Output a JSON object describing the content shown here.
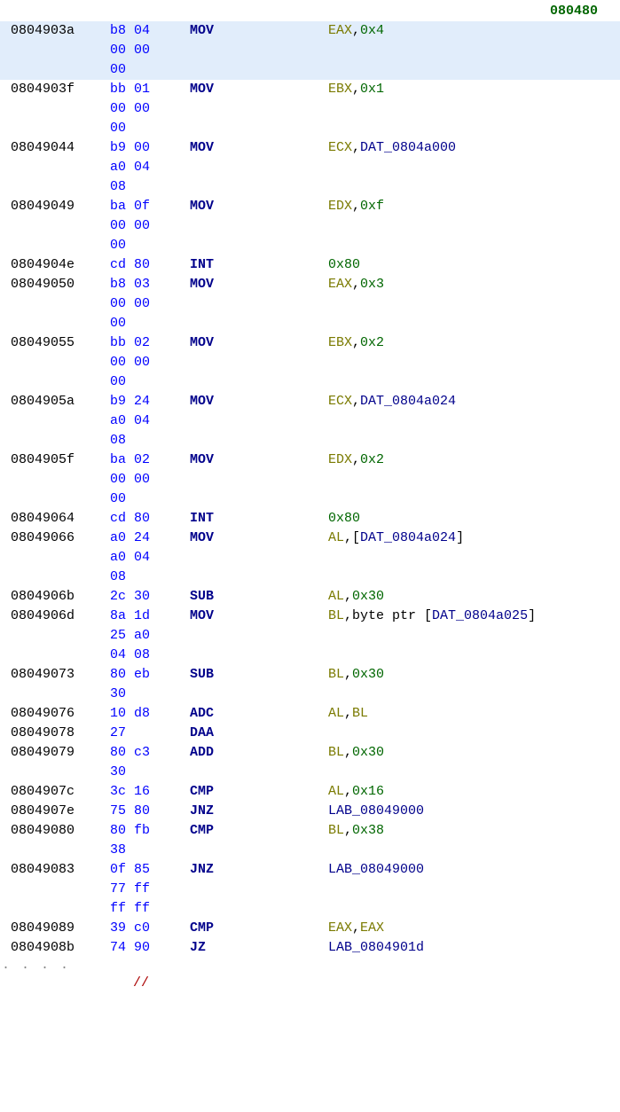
{
  "header_addr": "080480",
  "rows": [
    {
      "highlight": true,
      "addr": "0804903a",
      "bytes": [
        "b8 04",
        "00 00",
        "00"
      ],
      "mnemonic": "MOV",
      "ops": [
        {
          "t": "reg",
          "v": "EAX"
        },
        {
          "t": "punct",
          "v": ","
        },
        {
          "t": "num",
          "v": "0x4"
        }
      ]
    },
    {
      "addr": "0804903f",
      "bytes": [
        "bb 01",
        "00 00",
        "00"
      ],
      "mnemonic": "MOV",
      "ops": [
        {
          "t": "reg",
          "v": "EBX"
        },
        {
          "t": "punct",
          "v": ","
        },
        {
          "t": "num",
          "v": "0x1"
        }
      ]
    },
    {
      "addr": "08049044",
      "bytes": [
        "b9 00",
        "a0 04",
        "08"
      ],
      "mnemonic": "MOV",
      "ops": [
        {
          "t": "reg",
          "v": "ECX"
        },
        {
          "t": "punct",
          "v": ","
        },
        {
          "t": "label",
          "v": "DAT_0804a000"
        }
      ]
    },
    {
      "addr": "08049049",
      "bytes": [
        "ba 0f",
        "00 00",
        "00"
      ],
      "mnemonic": "MOV",
      "ops": [
        {
          "t": "reg",
          "v": "EDX"
        },
        {
          "t": "punct",
          "v": ","
        },
        {
          "t": "num",
          "v": "0xf"
        }
      ]
    },
    {
      "addr": "0804904e",
      "bytes": [
        "cd 80"
      ],
      "mnemonic": "INT",
      "ops": [
        {
          "t": "num",
          "v": "0x80"
        }
      ]
    },
    {
      "addr": "08049050",
      "bytes": [
        "b8 03",
        "00 00",
        "00"
      ],
      "mnemonic": "MOV",
      "ops": [
        {
          "t": "reg",
          "v": "EAX"
        },
        {
          "t": "punct",
          "v": ","
        },
        {
          "t": "num",
          "v": "0x3"
        }
      ]
    },
    {
      "addr": "08049055",
      "bytes": [
        "bb 02",
        "00 00",
        "00"
      ],
      "mnemonic": "MOV",
      "ops": [
        {
          "t": "reg",
          "v": "EBX"
        },
        {
          "t": "punct",
          "v": ","
        },
        {
          "t": "num",
          "v": "0x2"
        }
      ]
    },
    {
      "addr": "0804905a",
      "bytes": [
        "b9 24",
        "a0 04",
        "08"
      ],
      "mnemonic": "MOV",
      "ops": [
        {
          "t": "reg",
          "v": "ECX"
        },
        {
          "t": "punct",
          "v": ","
        },
        {
          "t": "label",
          "v": "DAT_0804a024"
        }
      ]
    },
    {
      "addr": "0804905f",
      "bytes": [
        "ba 02",
        "00 00",
        "00"
      ],
      "mnemonic": "MOV",
      "ops": [
        {
          "t": "reg",
          "v": "EDX"
        },
        {
          "t": "punct",
          "v": ","
        },
        {
          "t": "num",
          "v": "0x2"
        }
      ]
    },
    {
      "addr": "08049064",
      "bytes": [
        "cd 80"
      ],
      "mnemonic": "INT",
      "ops": [
        {
          "t": "num",
          "v": "0x80"
        }
      ]
    },
    {
      "addr": "08049066",
      "bytes": [
        "a0 24",
        "a0 04",
        "08"
      ],
      "mnemonic": "MOV",
      "ops": [
        {
          "t": "reg",
          "v": "AL"
        },
        {
          "t": "punct",
          "v": ",["
        },
        {
          "t": "label",
          "v": "DAT_0804a024"
        },
        {
          "t": "punct",
          "v": "]"
        }
      ]
    },
    {
      "addr": "0804906b",
      "bytes": [
        "2c 30"
      ],
      "mnemonic": "SUB",
      "ops": [
        {
          "t": "reg",
          "v": "AL"
        },
        {
          "t": "punct",
          "v": ","
        },
        {
          "t": "num",
          "v": "0x30"
        }
      ]
    },
    {
      "addr": "0804906d",
      "bytes": [
        "8a 1d",
        "25 a0",
        "04 08"
      ],
      "mnemonic": "MOV",
      "ops": [
        {
          "t": "reg",
          "v": "BL"
        },
        {
          "t": "punct",
          "v": ",byte ptr ["
        },
        {
          "t": "label",
          "v": "DAT_0804a025"
        },
        {
          "t": "punct",
          "v": "]"
        }
      ]
    },
    {
      "addr": "08049073",
      "bytes": [
        "80 eb",
        "30"
      ],
      "mnemonic": "SUB",
      "ops": [
        {
          "t": "reg",
          "v": "BL"
        },
        {
          "t": "punct",
          "v": ","
        },
        {
          "t": "num",
          "v": "0x30"
        }
      ]
    },
    {
      "addr": "08049076",
      "bytes": [
        "10 d8"
      ],
      "mnemonic": "ADC",
      "ops": [
        {
          "t": "reg",
          "v": "AL"
        },
        {
          "t": "punct",
          "v": ","
        },
        {
          "t": "reg",
          "v": "BL"
        }
      ]
    },
    {
      "addr": "08049078",
      "bytes": [
        "27"
      ],
      "mnemonic": "DAA",
      "ops": []
    },
    {
      "addr": "08049079",
      "bytes": [
        "80 c3",
        "30"
      ],
      "mnemonic": "ADD",
      "ops": [
        {
          "t": "reg",
          "v": "BL"
        },
        {
          "t": "punct",
          "v": ","
        },
        {
          "t": "num",
          "v": "0x30"
        }
      ]
    },
    {
      "addr": "0804907c",
      "bytes": [
        "3c 16"
      ],
      "mnemonic": "CMP",
      "ops": [
        {
          "t": "reg",
          "v": "AL"
        },
        {
          "t": "punct",
          "v": ","
        },
        {
          "t": "num",
          "v": "0x16"
        }
      ]
    },
    {
      "addr": "0804907e",
      "bytes": [
        "75 80"
      ],
      "mnemonic": "JNZ",
      "ops": [
        {
          "t": "label",
          "v": "LAB_08049000"
        }
      ]
    },
    {
      "addr": "08049080",
      "bytes": [
        "80 fb",
        "38"
      ],
      "mnemonic": "CMP",
      "ops": [
        {
          "t": "reg",
          "v": "BL"
        },
        {
          "t": "punct",
          "v": ","
        },
        {
          "t": "num",
          "v": "0x38"
        }
      ]
    },
    {
      "addr": "08049083",
      "bytes": [
        "0f 85",
        "77 ff",
        "ff ff"
      ],
      "mnemonic": "JNZ",
      "ops": [
        {
          "t": "label",
          "v": "LAB_08049000"
        }
      ]
    },
    {
      "addr": "08049089",
      "bytes": [
        "39 c0"
      ],
      "mnemonic": "CMP",
      "ops": [
        {
          "t": "reg",
          "v": "EAX"
        },
        {
          "t": "punct",
          "v": ","
        },
        {
          "t": "reg",
          "v": "EAX"
        }
      ]
    },
    {
      "addr": "0804908b",
      "bytes": [
        "74 90"
      ],
      "mnemonic": "JZ",
      "ops": [
        {
          "t": "label",
          "v": "LAB_0804901d"
        }
      ]
    }
  ],
  "footer_dots": ". . . .",
  "footer_text": "//"
}
